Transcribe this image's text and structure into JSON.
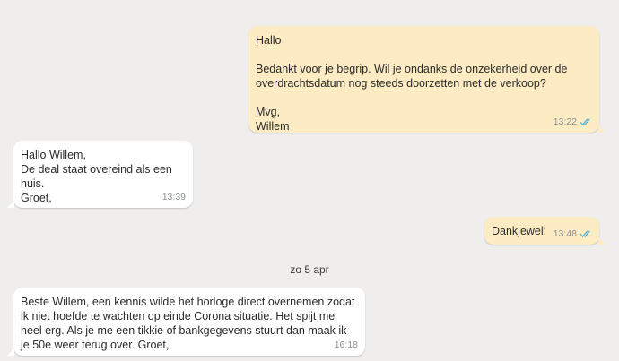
{
  "messages": [
    {
      "direction": "outgoing",
      "text": "Hallo\n\nBedankt voor je begrip. Wil je ondanks de onzekerheid over de overdrachtsdatum nog steeds doorzetten met de verkoop?\n\nMvg,\nWillem",
      "time": "13:22",
      "status_icon": "double-check-read-icon"
    },
    {
      "direction": "incoming",
      "text": "Hallo Willem,\nDe deal staat overeind als een huis.\nGroet,",
      "time": "13:39"
    },
    {
      "direction": "outgoing",
      "text": "Dankjewel!",
      "time": "13:48",
      "status_icon": "double-check-read-icon"
    },
    {
      "direction": "incoming",
      "text": "Beste Willem, een kennis wilde het horloge direct overnemen zodat ik niet hoefde te wachten op einde Corona situatie. Het spijt me heel erg. Als je me een tikkie of bankgegevens stuurt dan maak ik je 50e weer terug over. Groet,",
      "time": "16:18"
    }
  ],
  "date_separator": "zo 5 apr",
  "colors": {
    "background": "#efeeec",
    "outgoing_bubble": "#fdecc3",
    "incoming_bubble": "#ffffff",
    "read_ticks": "#4fb3d9"
  }
}
